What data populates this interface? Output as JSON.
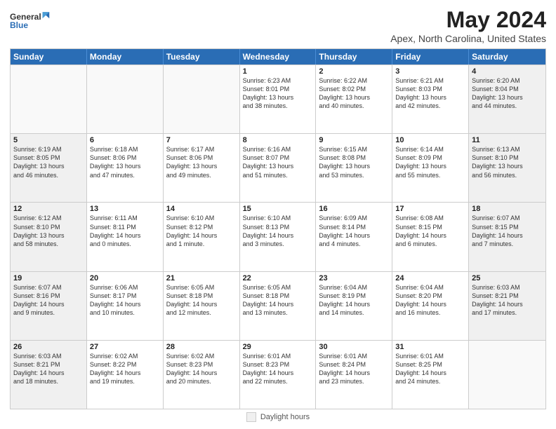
{
  "header": {
    "logo_general": "General",
    "logo_blue": "Blue",
    "main_title": "May 2024",
    "subtitle": "Apex, North Carolina, United States"
  },
  "calendar": {
    "days_of_week": [
      "Sunday",
      "Monday",
      "Tuesday",
      "Wednesday",
      "Thursday",
      "Friday",
      "Saturday"
    ],
    "weeks": [
      [
        {
          "day": "",
          "empty": true
        },
        {
          "day": "",
          "empty": true
        },
        {
          "day": "",
          "empty": true
        },
        {
          "day": "1",
          "lines": [
            "Sunrise: 6:23 AM",
            "Sunset: 8:01 PM",
            "Daylight: 13 hours",
            "and 38 minutes."
          ]
        },
        {
          "day": "2",
          "lines": [
            "Sunrise: 6:22 AM",
            "Sunset: 8:02 PM",
            "Daylight: 13 hours",
            "and 40 minutes."
          ]
        },
        {
          "day": "3",
          "lines": [
            "Sunrise: 6:21 AM",
            "Sunset: 8:03 PM",
            "Daylight: 13 hours",
            "and 42 minutes."
          ]
        },
        {
          "day": "4",
          "lines": [
            "Sunrise: 6:20 AM",
            "Sunset: 8:04 PM",
            "Daylight: 13 hours",
            "and 44 minutes."
          ]
        }
      ],
      [
        {
          "day": "5",
          "lines": [
            "Sunrise: 6:19 AM",
            "Sunset: 8:05 PM",
            "Daylight: 13 hours",
            "and 46 minutes."
          ]
        },
        {
          "day": "6",
          "lines": [
            "Sunrise: 6:18 AM",
            "Sunset: 8:06 PM",
            "Daylight: 13 hours",
            "and 47 minutes."
          ]
        },
        {
          "day": "7",
          "lines": [
            "Sunrise: 6:17 AM",
            "Sunset: 8:06 PM",
            "Daylight: 13 hours",
            "and 49 minutes."
          ]
        },
        {
          "day": "8",
          "lines": [
            "Sunrise: 6:16 AM",
            "Sunset: 8:07 PM",
            "Daylight: 13 hours",
            "and 51 minutes."
          ]
        },
        {
          "day": "9",
          "lines": [
            "Sunrise: 6:15 AM",
            "Sunset: 8:08 PM",
            "Daylight: 13 hours",
            "and 53 minutes."
          ]
        },
        {
          "day": "10",
          "lines": [
            "Sunrise: 6:14 AM",
            "Sunset: 8:09 PM",
            "Daylight: 13 hours",
            "and 55 minutes."
          ]
        },
        {
          "day": "11",
          "lines": [
            "Sunrise: 6:13 AM",
            "Sunset: 8:10 PM",
            "Daylight: 13 hours",
            "and 56 minutes."
          ]
        }
      ],
      [
        {
          "day": "12",
          "lines": [
            "Sunrise: 6:12 AM",
            "Sunset: 8:10 PM",
            "Daylight: 13 hours",
            "and 58 minutes."
          ]
        },
        {
          "day": "13",
          "lines": [
            "Sunrise: 6:11 AM",
            "Sunset: 8:11 PM",
            "Daylight: 14 hours",
            "and 0 minutes."
          ]
        },
        {
          "day": "14",
          "lines": [
            "Sunrise: 6:10 AM",
            "Sunset: 8:12 PM",
            "Daylight: 14 hours",
            "and 1 minute."
          ]
        },
        {
          "day": "15",
          "lines": [
            "Sunrise: 6:10 AM",
            "Sunset: 8:13 PM",
            "Daylight: 14 hours",
            "and 3 minutes."
          ]
        },
        {
          "day": "16",
          "lines": [
            "Sunrise: 6:09 AM",
            "Sunset: 8:14 PM",
            "Daylight: 14 hours",
            "and 4 minutes."
          ]
        },
        {
          "day": "17",
          "lines": [
            "Sunrise: 6:08 AM",
            "Sunset: 8:15 PM",
            "Daylight: 14 hours",
            "and 6 minutes."
          ]
        },
        {
          "day": "18",
          "lines": [
            "Sunrise: 6:07 AM",
            "Sunset: 8:15 PM",
            "Daylight: 14 hours",
            "and 7 minutes."
          ]
        }
      ],
      [
        {
          "day": "19",
          "lines": [
            "Sunrise: 6:07 AM",
            "Sunset: 8:16 PM",
            "Daylight: 14 hours",
            "and 9 minutes."
          ]
        },
        {
          "day": "20",
          "lines": [
            "Sunrise: 6:06 AM",
            "Sunset: 8:17 PM",
            "Daylight: 14 hours",
            "and 10 minutes."
          ]
        },
        {
          "day": "21",
          "lines": [
            "Sunrise: 6:05 AM",
            "Sunset: 8:18 PM",
            "Daylight: 14 hours",
            "and 12 minutes."
          ]
        },
        {
          "day": "22",
          "lines": [
            "Sunrise: 6:05 AM",
            "Sunset: 8:18 PM",
            "Daylight: 14 hours",
            "and 13 minutes."
          ]
        },
        {
          "day": "23",
          "lines": [
            "Sunrise: 6:04 AM",
            "Sunset: 8:19 PM",
            "Daylight: 14 hours",
            "and 14 minutes."
          ]
        },
        {
          "day": "24",
          "lines": [
            "Sunrise: 6:04 AM",
            "Sunset: 8:20 PM",
            "Daylight: 14 hours",
            "and 16 minutes."
          ]
        },
        {
          "day": "25",
          "lines": [
            "Sunrise: 6:03 AM",
            "Sunset: 8:21 PM",
            "Daylight: 14 hours",
            "and 17 minutes."
          ]
        }
      ],
      [
        {
          "day": "26",
          "lines": [
            "Sunrise: 6:03 AM",
            "Sunset: 8:21 PM",
            "Daylight: 14 hours",
            "and 18 minutes."
          ]
        },
        {
          "day": "27",
          "lines": [
            "Sunrise: 6:02 AM",
            "Sunset: 8:22 PM",
            "Daylight: 14 hours",
            "and 19 minutes."
          ]
        },
        {
          "day": "28",
          "lines": [
            "Sunrise: 6:02 AM",
            "Sunset: 8:23 PM",
            "Daylight: 14 hours",
            "and 20 minutes."
          ]
        },
        {
          "day": "29",
          "lines": [
            "Sunrise: 6:01 AM",
            "Sunset: 8:23 PM",
            "Daylight: 14 hours",
            "and 22 minutes."
          ]
        },
        {
          "day": "30",
          "lines": [
            "Sunrise: 6:01 AM",
            "Sunset: 8:24 PM",
            "Daylight: 14 hours",
            "and 23 minutes."
          ]
        },
        {
          "day": "31",
          "lines": [
            "Sunrise: 6:01 AM",
            "Sunset: 8:25 PM",
            "Daylight: 14 hours",
            "and 24 minutes."
          ]
        },
        {
          "day": "",
          "empty": true
        }
      ]
    ]
  },
  "footer": {
    "legend_label": "Daylight hours",
    "shaded_color": "#f0f0f0"
  }
}
